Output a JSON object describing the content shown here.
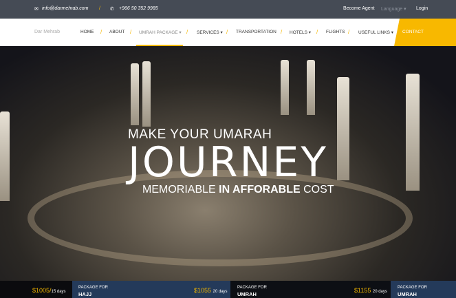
{
  "topbar": {
    "email": "info@darmehrab.com",
    "phone": "+966 50 352 9985",
    "become_agent": "Become Agent",
    "language": "Language ▾",
    "login": "Login"
  },
  "nav": {
    "brand": "Dar Mehrab",
    "items": [
      "HOME",
      "ABOUT",
      "UMRAH PACKAGE ▾",
      "SERVICES ▾",
      "TRANSPORTATION",
      "HOTELS ▾",
      "FLIGHTS",
      "USEFUL LINKS ▾"
    ],
    "contact": "CONTACT",
    "separator": "/"
  },
  "hero": {
    "line1": "MAKE YOUR UMARAH",
    "line2": "JOURNEY",
    "line3_a": "MEMORIABLE",
    "line3_b": "IN AFFORABLE",
    "line3_c": "COST"
  },
  "packages": [
    {
      "price": "$1005/",
      "duration": "15 days",
      "label": "PACKAGE FOR",
      "name": "HAJJ"
    },
    {
      "price": "$1055",
      "duration": "20 days",
      "label": "PACKAGE FOR",
      "name": "UMRAH"
    },
    {
      "price": "$1155",
      "duration": "20 days",
      "label": "PACKAGE FOR",
      "name": "UMRAH"
    }
  ],
  "colors": {
    "accent": "#f8b800",
    "topbar": "#454b55",
    "package_blue": "#243a5a"
  }
}
